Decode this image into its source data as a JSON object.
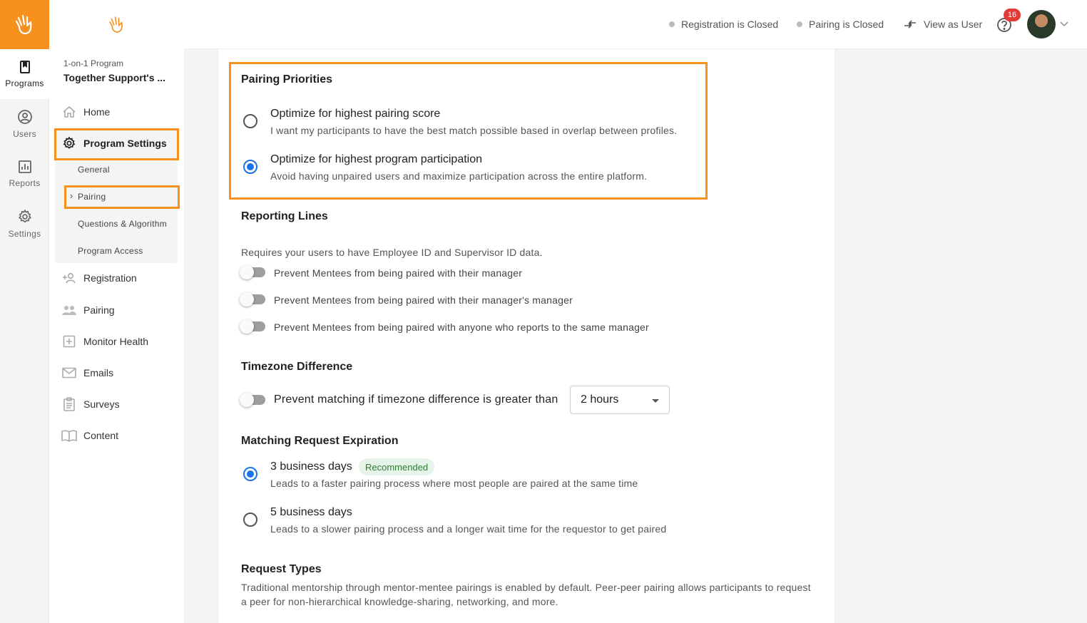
{
  "rail": {
    "items": [
      {
        "label": "Programs",
        "icon": "book-icon"
      },
      {
        "label": "Users",
        "icon": "user-circle-icon"
      },
      {
        "label": "Reports",
        "icon": "bar-chart-icon"
      },
      {
        "label": "Settings",
        "icon": "gear-icon"
      }
    ]
  },
  "program": {
    "type": "1-on-1 Program",
    "name": "Together Support's ..."
  },
  "nav": {
    "home": "Home",
    "program_settings": "Program Settings",
    "sub": {
      "general": "General",
      "pairing": "Pairing",
      "questions": "Questions & Algorithm",
      "access": "Program Access"
    },
    "registration": "Registration",
    "pairing": "Pairing",
    "monitor_health": "Monitor Health",
    "emails": "Emails",
    "surveys": "Surveys",
    "content": "Content"
  },
  "topbar": {
    "registration_status": "Registration is Closed",
    "pairing_status": "Pairing is Closed",
    "view_as_user": "View as User",
    "notification_count": "16"
  },
  "pairing_priorities": {
    "title": "Pairing Priorities",
    "options": [
      {
        "title": "Optimize for highest pairing score",
        "desc": "I want my participants to have the best match possible based in overlap between profiles.",
        "selected": false
      },
      {
        "title": "Optimize for highest program participation",
        "desc": "Avoid having unpaired users and maximize participation across the entire platform.",
        "selected": true
      }
    ]
  },
  "reporting_lines": {
    "title": "Reporting Lines",
    "desc": "Requires your users to have Employee ID and Supervisor ID data.",
    "toggles": [
      {
        "label": "Prevent Mentees from being paired with their manager",
        "on": false
      },
      {
        "label": "Prevent Mentees from being paired with their manager's manager",
        "on": false
      },
      {
        "label": "Prevent Mentees from being paired with anyone who reports to the same manager",
        "on": false
      }
    ]
  },
  "timezone": {
    "title": "Timezone Difference",
    "label": "Prevent matching if timezone difference is greater than",
    "selected": "2 hours",
    "on": false
  },
  "expiration": {
    "title": "Matching Request Expiration",
    "options": [
      {
        "title": "3 business days",
        "badge": "Recommended",
        "desc": "Leads to a faster pairing process where most people are paired at the same time",
        "selected": true
      },
      {
        "title": "5 business days",
        "desc": "Leads to a slower pairing process and a longer wait time for the requestor to get paired",
        "selected": false
      }
    ]
  },
  "request_types": {
    "title": "Request Types",
    "desc_line1": "Traditional mentorship through mentor-mentee pairings is enabled by default. Peer-peer pairing allows participants to request",
    "desc_line2": "a peer for non-hierarchical knowledge-sharing, networking, and more."
  },
  "colors": {
    "accent": "#f7911e",
    "primary": "#1a73e8",
    "badge": "#e53935",
    "success_bg": "#e6f4ea"
  }
}
